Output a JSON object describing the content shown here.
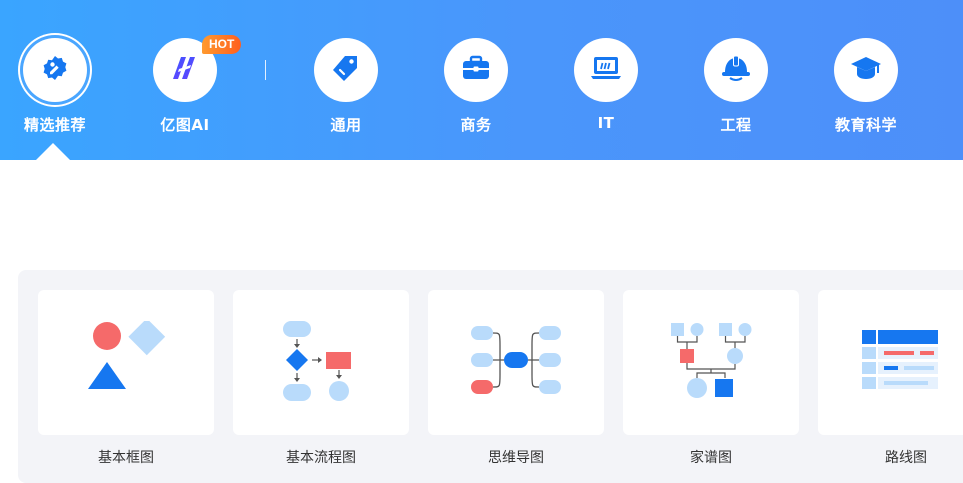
{
  "categories": [
    {
      "label": "精选推荐",
      "icon": "recommend-badge-icon"
    },
    {
      "label": "亿图AI",
      "icon": "edraw-ai-logo-icon",
      "badge": "HOT"
    },
    {
      "label": "通用",
      "icon": "tag-icon"
    },
    {
      "label": "商务",
      "icon": "briefcase-icon"
    },
    {
      "label": "IT",
      "icon": "laptop-icon"
    },
    {
      "label": "工程",
      "icon": "hard-hat-icon"
    },
    {
      "label": "教育科学",
      "icon": "graduation-cap-icon"
    }
  ],
  "active_category": "精选推荐",
  "templates": [
    {
      "name": "基本框图",
      "icon": "basic-block-diagram-icon"
    },
    {
      "name": "基本流程图",
      "icon": "basic-flowchart-icon"
    },
    {
      "name": "思维导图",
      "icon": "mind-map-icon"
    },
    {
      "name": "家谱图",
      "icon": "family-tree-icon"
    },
    {
      "name": "路线图",
      "icon": "roadmap-icon"
    }
  ],
  "colors": {
    "header_start": "#3aa5ff",
    "header_end": "#4d8ff9",
    "icon_blue": "#1677f0",
    "light_blue": "#b9dbfb",
    "accent_red": "#f56a6a",
    "hot_orange": "#ff6a21",
    "panel_bg": "#f3f4f8"
  }
}
